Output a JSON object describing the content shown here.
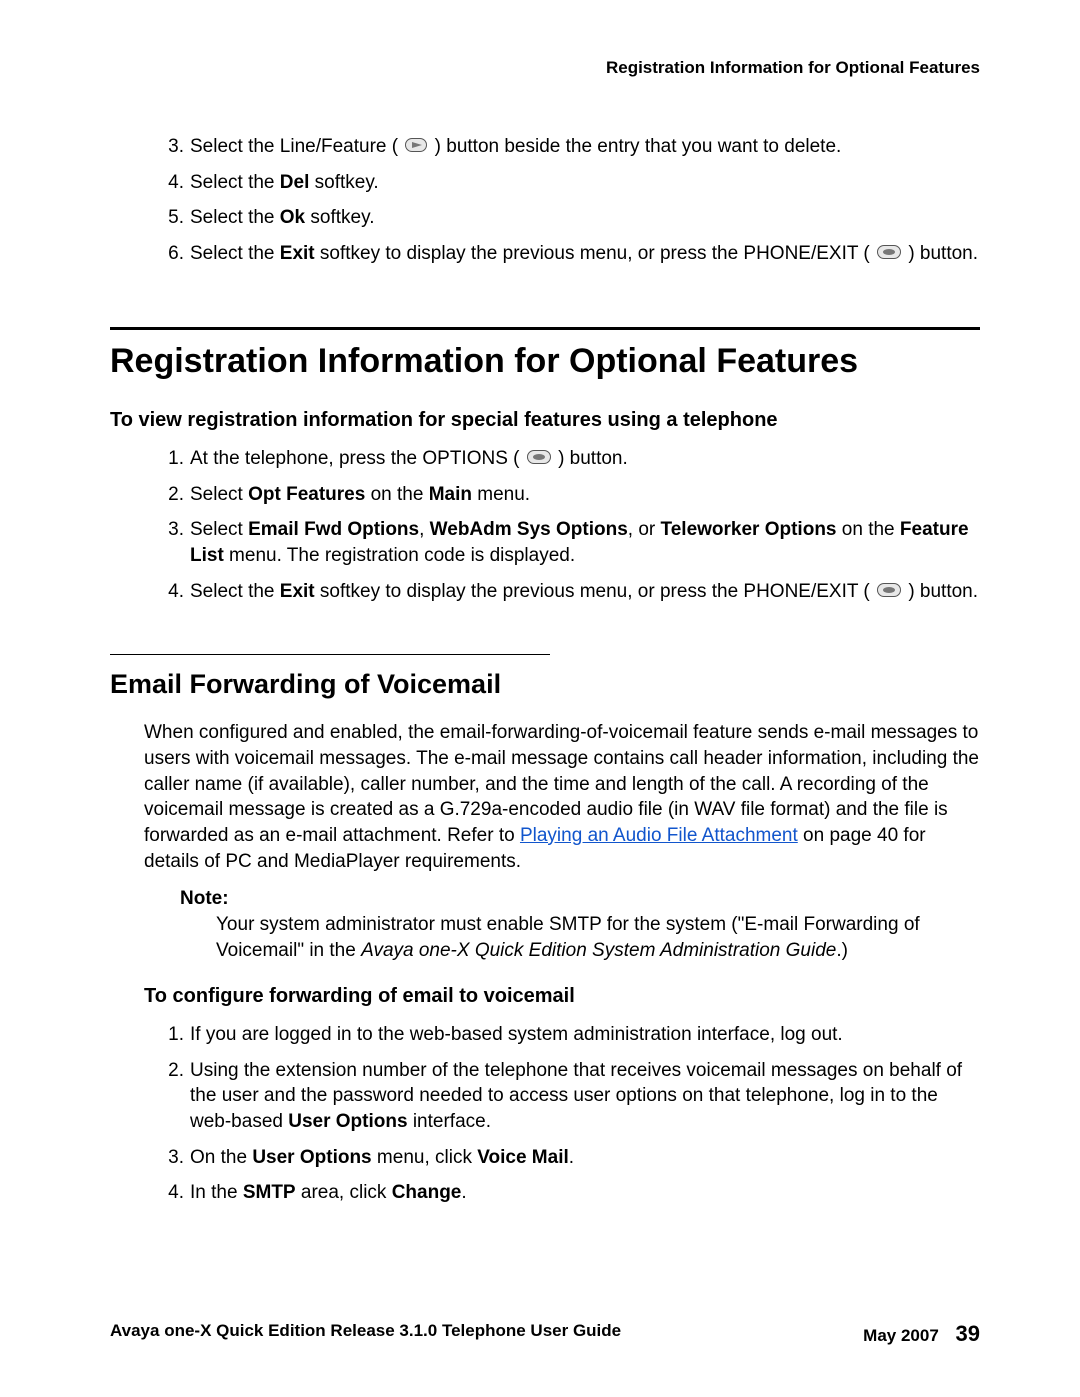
{
  "runningHeader": "Registration Information for Optional Features",
  "topSteps": {
    "s3_a": "Select the Line/Feature (",
    "s3_b": ") button beside the entry that you want to delete.",
    "s4_a": "Select the ",
    "s4_b": "Del",
    "s4_c": " softkey.",
    "s5_a": "Select the ",
    "s5_b": "Ok",
    "s5_c": " softkey.",
    "s6_a": "Select the ",
    "s6_b": "Exit",
    "s6_c": " softkey to display the previous menu, or press the PHONE/EXIT ( ",
    "s6_d": " ) button."
  },
  "sectionTitle": "Registration Information for Optional Features",
  "sub1": "To view registration information for special features using a telephone",
  "regSteps": {
    "s1_a": "At the telephone, press the OPTIONS ( ",
    "s1_b": " ) button.",
    "s2_a": "Select ",
    "s2_b": "Opt Features",
    "s2_c": " on the ",
    "s2_d": "Main",
    "s2_e": " menu.",
    "s3_a": "Select ",
    "s3_b": "Email Fwd Options",
    "s3_c": ", ",
    "s3_d": "WebAdm Sys Options",
    "s3_e": ", or ",
    "s3_f": "Teleworker Options",
    "s3_g": " on the ",
    "s3_h": "Feature List",
    "s3_i": " menu. The registration code is displayed.",
    "s4_a": "Select the ",
    "s4_b": "Exit",
    "s4_c": " softkey to display the previous menu, or press the PHONE/EXIT ( ",
    "s4_d": " ) button."
  },
  "subsectionTitle": "Email Forwarding of Voicemail",
  "para1_a": "When configured and enabled, the email-forwarding-of-voicemail feature sends e-mail messages to users with voicemail messages. The e-mail message contains call header information, including the caller name (if available), caller number, and the time and length of the call. A recording of the voicemail message is created as a G.729a-encoded audio file (in WAV file format) and the file is forwarded as an e-mail attachment. Refer to ",
  "para1_link": "Playing an Audio File Attachment",
  "para1_b": " on page 40 for details of PC and MediaPlayer requirements.",
  "noteLabel": "Note:",
  "noteText_a": "Your system administrator must enable SMTP for the system (\"E-mail Forwarding of Voicemail\" in the ",
  "noteText_b": "Avaya one-X Quick Edition System Administration Guide",
  "noteText_c": ".)",
  "sub2": "To configure forwarding of email to voicemail",
  "cfgSteps": {
    "s1": "If you are logged in to the web-based system administration interface, log out.",
    "s2_a": "Using the extension number of the telephone that receives voicemail messages on behalf of the user and the password needed to access user options on that telephone, log in to the web-based ",
    "s2_b": "User Options",
    "s2_c": " interface.",
    "s3_a": "On the ",
    "s3_b": "User Options",
    "s3_c": " menu, click ",
    "s3_d": "Voice Mail",
    "s3_e": ".",
    "s4_a": "In the ",
    "s4_b": "SMTP",
    "s4_c": " area, click ",
    "s4_d": "Change",
    "s4_e": "."
  },
  "footerLeft": "Avaya one-X Quick Edition Release 3.1.0 Telephone User Guide",
  "footerDate": "May 2007",
  "footerPage": "39",
  "nums": {
    "n1": "1.",
    "n2": "2.",
    "n3": "3.",
    "n4": "4.",
    "n5": "5.",
    "n6": "6."
  }
}
